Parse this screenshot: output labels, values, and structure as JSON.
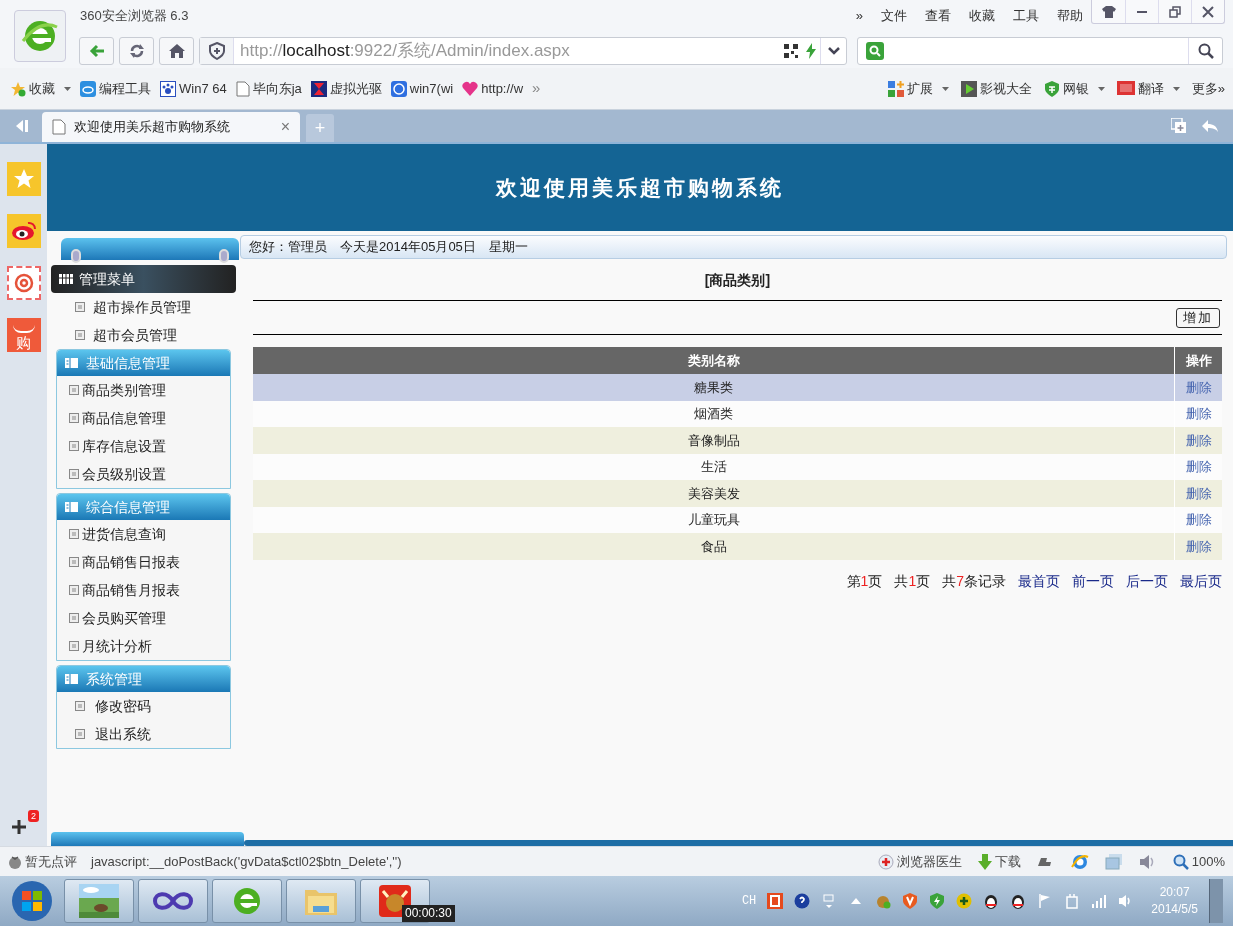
{
  "browser": {
    "title": "360安全浏览器 6.3",
    "menu": [
      "»",
      "文件",
      "查看",
      "收藏",
      "工具",
      "帮助"
    ],
    "url_scheme": "http://",
    "url_host": "localhost",
    "url_rest": ":9922/系统/Admin/index.aspx"
  },
  "bookmarks": [
    {
      "label": "收藏",
      "kind": "star"
    },
    {
      "label": "编程工具",
      "kind": "cloud"
    },
    {
      "label": "Win7 64",
      "kind": "paw"
    },
    {
      "label": "毕向东ja",
      "kind": "page"
    },
    {
      "label": "虚拟光驱",
      "kind": "disc"
    },
    {
      "label": "win7(wi",
      "kind": "globe"
    },
    {
      "label": "http://w",
      "kind": "heart"
    }
  ],
  "bookmarks_more": "»",
  "toolbar_right": [
    {
      "label": "扩展",
      "kind": "grid"
    },
    {
      "label": "影视大全",
      "kind": "film"
    },
    {
      "label": "网银",
      "kind": "shield"
    },
    {
      "label": "翻译",
      "kind": "dict"
    }
  ],
  "toolbar_more": "更多»",
  "tab": {
    "title": "欢迎使用美乐超市购物系统",
    "close": "×",
    "new": "+"
  },
  "rail": {
    "shop_label": "购",
    "badge": "2"
  },
  "page": {
    "header": "欢迎使用美乐超市购物系统",
    "greeting": "您好：管理员　今天是2014年05月05日　星期一"
  },
  "sidebar": {
    "title": "管理菜单",
    "top_items": [
      "超市操作员管理",
      "超市会员管理"
    ],
    "groups": [
      {
        "title": "基础信息管理",
        "items": [
          "商品类别管理",
          "商品信息管理",
          "库存信息设置",
          "会员级别设置"
        ]
      },
      {
        "title": "综合信息管理",
        "items": [
          "进货信息查询",
          "商品销售日报表",
          "商品销售月报表",
          "会员购买管理",
          "月统计分析"
        ]
      },
      {
        "title": "系统管理",
        "items": [
          "修改密码",
          "退出系统"
        ]
      }
    ]
  },
  "main": {
    "title": "[商品类别]",
    "add_button": "增加",
    "columns": [
      "类别名称",
      "操作"
    ],
    "rows": [
      {
        "name": "糖果类",
        "action": "删除",
        "selected": true
      },
      {
        "name": "烟酒类",
        "action": "删除",
        "selected": false
      },
      {
        "name": "音像制品",
        "action": "删除",
        "selected": false
      },
      {
        "name": "生活",
        "action": "删除",
        "selected": false
      },
      {
        "name": "美容美发",
        "action": "删除",
        "selected": false
      },
      {
        "name": "儿童玩具",
        "action": "删除",
        "selected": false
      },
      {
        "name": "食品",
        "action": "删除",
        "selected": false
      }
    ],
    "pager_info": [
      {
        "before": "第",
        "num": "1",
        "after": "页"
      },
      {
        "before": "共",
        "num": "1",
        "after": "页"
      },
      {
        "before": "共",
        "num": "7",
        "after": "条记录"
      }
    ],
    "pager_links": [
      "最首页",
      "前一页",
      "后一页",
      "最后页"
    ]
  },
  "status": {
    "rating": "暂无点评",
    "link": "javascript:__doPostBack('gvData$ctl02$btn_Delete','')",
    "doctor": "浏览器医生",
    "download": "下载",
    "zoom": "100%"
  },
  "taskbar": {
    "timer": "00:00:30",
    "lang": "CH",
    "time": "20:07",
    "date": "2014/5/5"
  }
}
